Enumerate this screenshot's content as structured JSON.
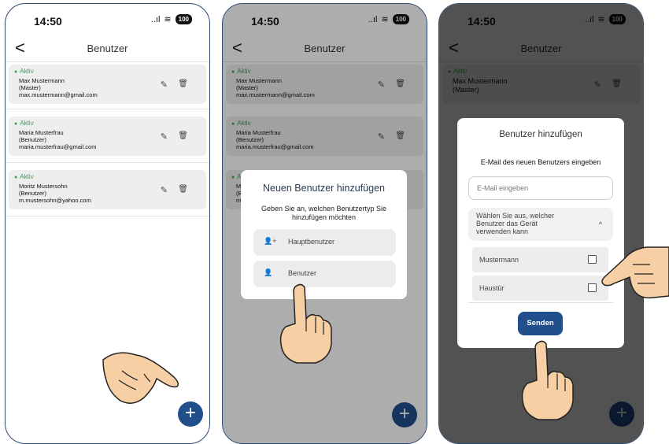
{
  "status": {
    "time": "14:50",
    "signal": "..ıl",
    "wifi": "≋",
    "battery": "100"
  },
  "header": {
    "title": "Benutzer",
    "back": "<"
  },
  "users": [
    {
      "status": "Aktiv",
      "name": "Max Mustermann",
      "role": "(Master)",
      "email": "max.mustermann@gmail.com"
    },
    {
      "status": "Aktiv",
      "name": "Maria Musterfrau",
      "role": "(Benutzer)",
      "email": "maria.musterfrau@gmail.com"
    },
    {
      "status": "Aktiv",
      "name": "Moritz Mustersohn",
      "role": "(Benutzer)",
      "email": "m.mustersohn@yahoo.com"
    }
  ],
  "dialog_type": {
    "title": "Neuen Benutzer hinzufügen",
    "subtitle": "Geben Sie an, welchen Benutzertyp Sie hinzufügen möchten",
    "options": [
      {
        "icon": "person-add-icon",
        "label": "Hauptbenutzer"
      },
      {
        "icon": "person-icon",
        "label": "Benutzer"
      }
    ]
  },
  "dialog_add": {
    "title": "Benutzer hinzufügen",
    "subtitle": "E-Mail des neuen Benutzers eingeben",
    "email_placeholder": "E-Mail eingeben",
    "dropdown_label": "Wählen Sie aus, welcher Benutzer das Gerät verwenden kann",
    "devices": [
      "Mustermann",
      "Haustür"
    ],
    "send_label": "Senden"
  },
  "fab": {
    "label": "+"
  },
  "colors": {
    "accent": "#214f8b",
    "active": "#2ea84a",
    "frame": "#2c4a72",
    "hand": "#f6cfa4"
  }
}
